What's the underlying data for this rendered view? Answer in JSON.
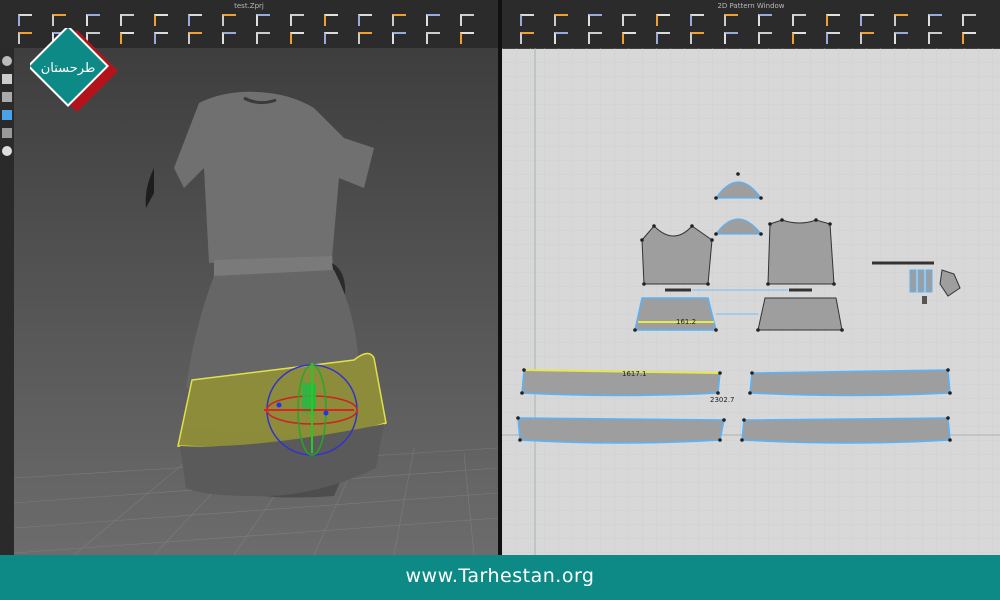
{
  "window_3d": {
    "title": "test.Zprj",
    "toolbar_icons": [
      "select-icon",
      "move-icon",
      "transform-icon",
      "polygon-icon",
      "tack-icon",
      "fold-icon",
      "pin-icon",
      "texture-icon",
      "fabric-icon",
      "avatar-icon",
      "measure-icon",
      "button-icon",
      "zipper-icon",
      "stitch-icon"
    ]
  },
  "window_2d": {
    "title": "2D Pattern Window",
    "toolbar_icons": [
      "transform-pattern-icon",
      "edit-point-icon",
      "edit-curve-icon",
      "polygon-tool-icon",
      "rectangle-tool-icon",
      "circle-tool-icon",
      "internal-line-icon",
      "dart-icon",
      "segment-sewing-icon",
      "free-sewing-icon",
      "fold-icon",
      "notch-icon",
      "trace-icon",
      "symmetry-icon"
    ],
    "measurements": [
      "161.2",
      "1617.1",
      "2302.7"
    ]
  },
  "logo": {
    "text": "طرحستان"
  },
  "footer": {
    "url": "www.Tarhestan.org"
  },
  "colors": {
    "accent": "#0d8a85",
    "highlight_yellow": "#e8e84a",
    "selection_blue": "#56b4ff",
    "pattern_fill": "#9e9e9e"
  }
}
